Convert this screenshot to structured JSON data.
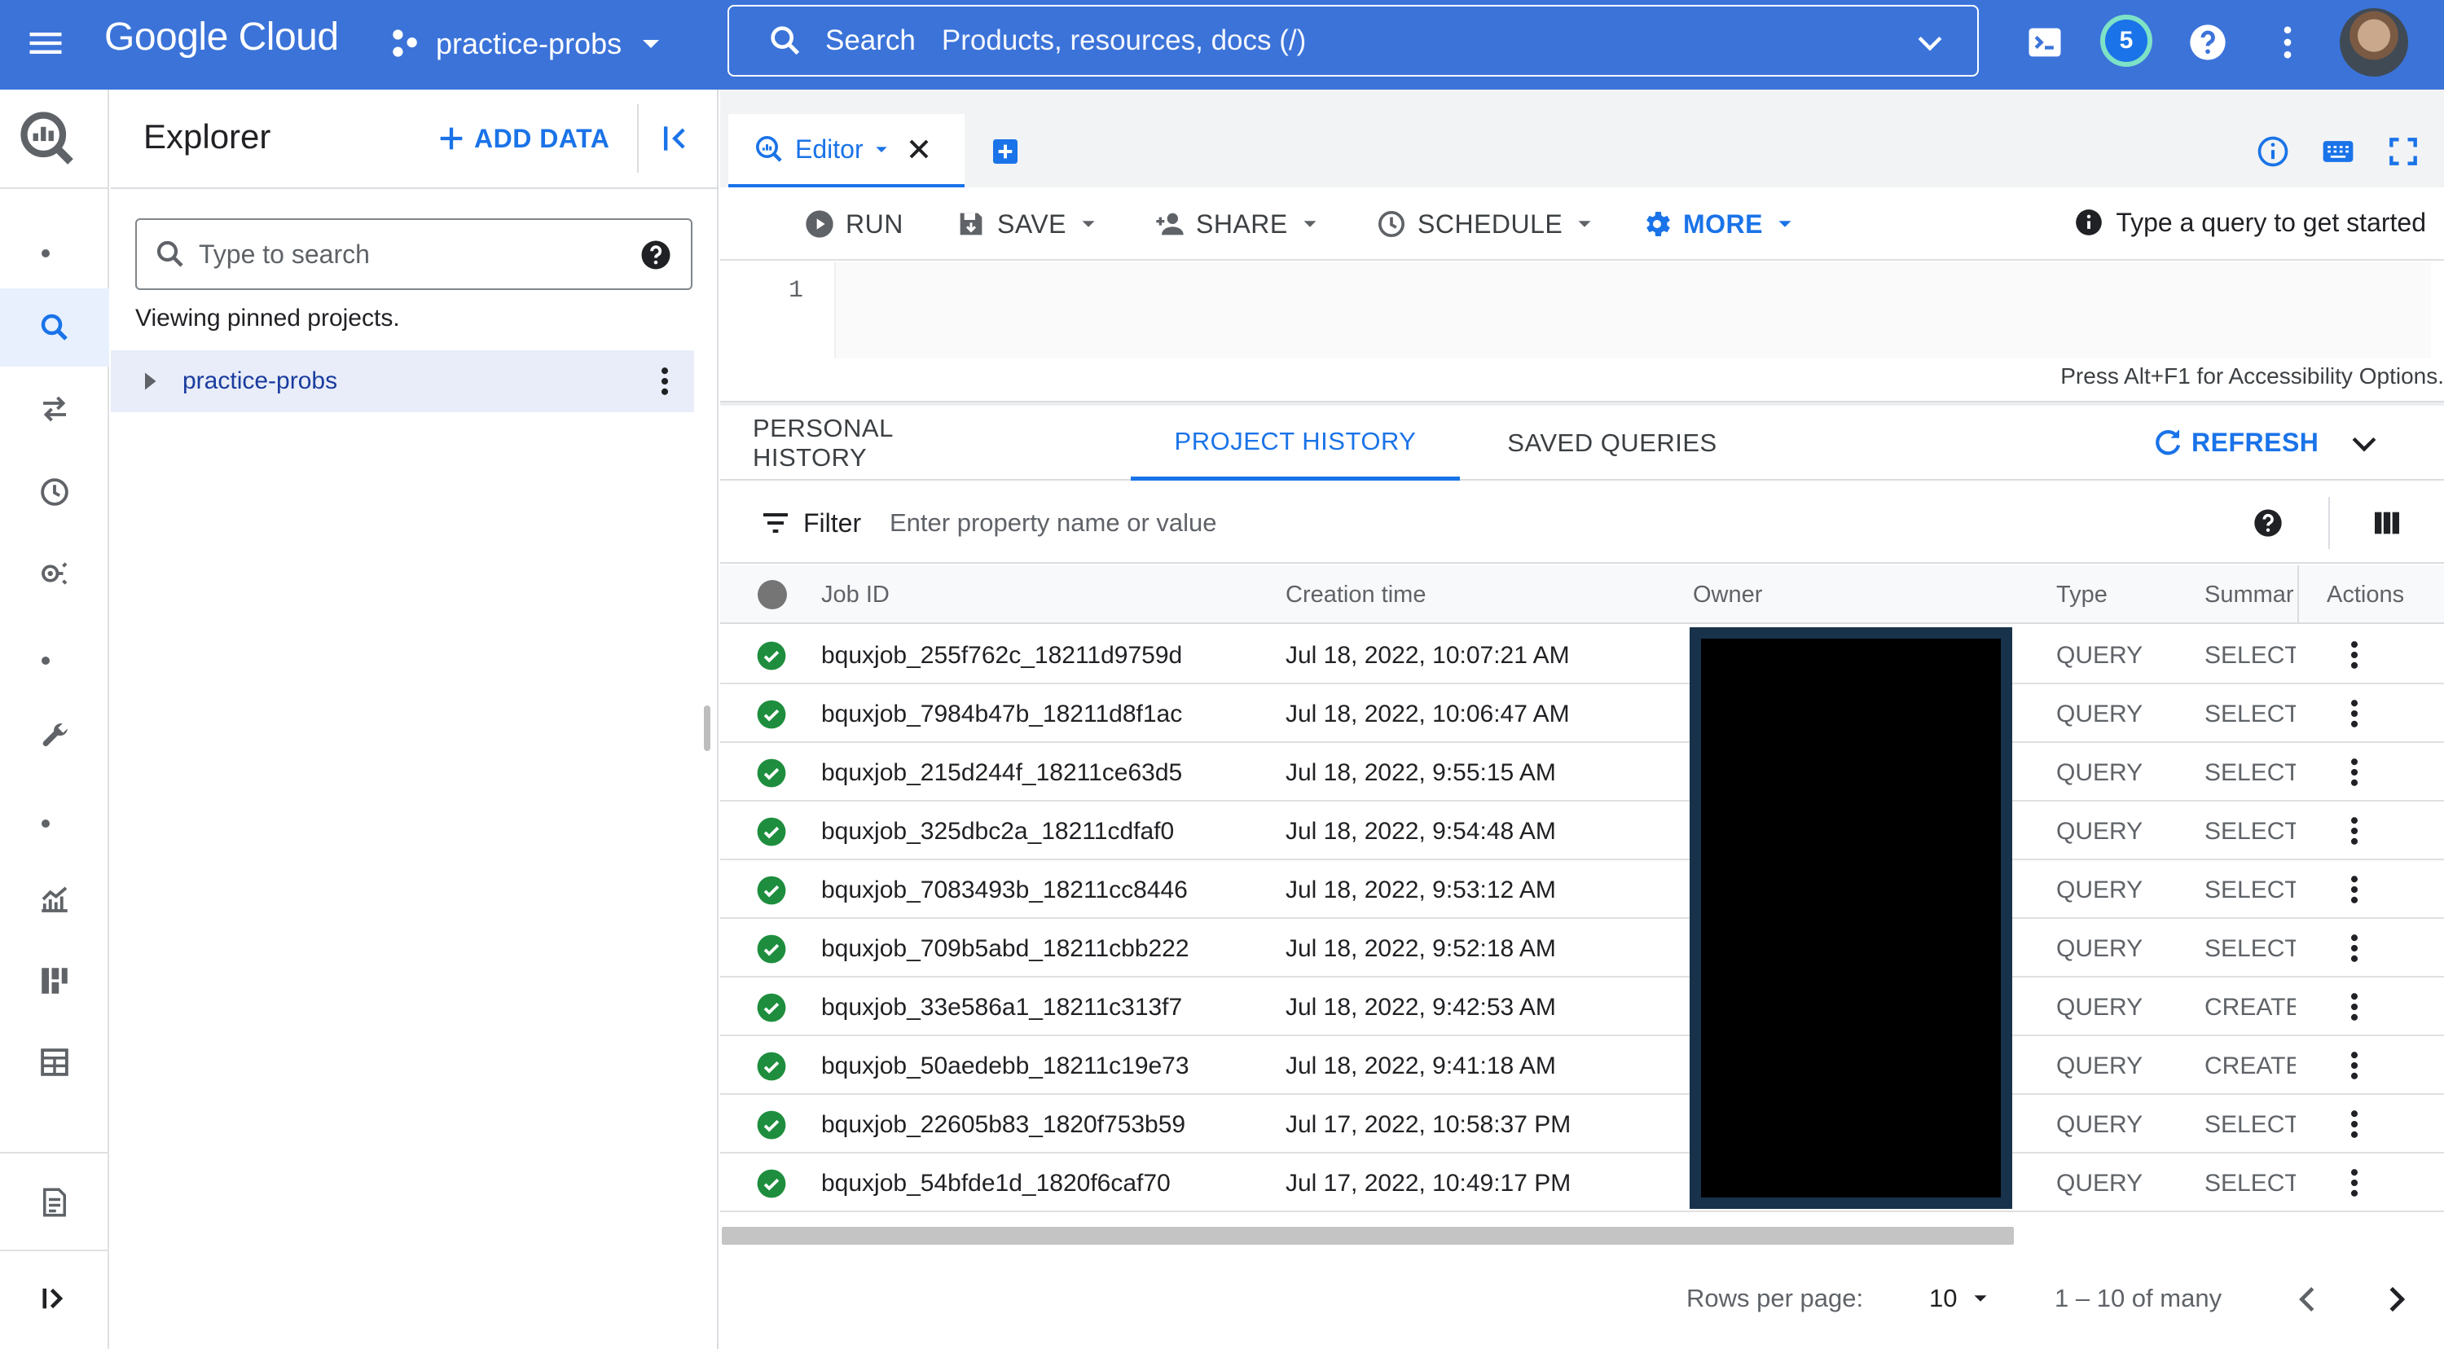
{
  "header": {
    "logo": "Google Cloud",
    "project": "practice-probs",
    "search_label": "Search",
    "search_placeholder": "Products, resources, docs (/)",
    "notifications_count": "5",
    "icons": [
      "menu-icon",
      "cloud-shell-icon",
      "help-icon",
      "more-vert-icon",
      "avatar"
    ]
  },
  "rail": {
    "items": [
      "bigquery-logo",
      "search-icon",
      "transfers-icon",
      "scheduled-queries-icon",
      "analytics-hub-icon",
      "wrench-icon",
      "monitoring-icon",
      "dashboard-icon",
      "table-icon",
      "release-notes-icon",
      "expand-rail-icon"
    ]
  },
  "explorer": {
    "title": "Explorer",
    "add_data": "ADD DATA",
    "search_placeholder": "Type to search",
    "viewing": "Viewing pinned projects.",
    "projects": [
      "practice-probs"
    ]
  },
  "editor": {
    "tab_label": "Editor",
    "toolbar": {
      "run": "RUN",
      "save": "SAVE",
      "share": "SHARE",
      "schedule": "SCHEDULE",
      "more": "MORE"
    },
    "hint": "Type a query to get started",
    "line_number": "1",
    "accessibility": "Press Alt+F1 for Accessibility Options."
  },
  "history": {
    "tabs": [
      "PERSONAL HISTORY",
      "PROJECT HISTORY",
      "SAVED QUERIES"
    ],
    "active_tab": "PROJECT HISTORY",
    "refresh": "REFRESH",
    "filter_label": "Filter",
    "filter_placeholder": "Enter property name or value",
    "columns": [
      "Job ID",
      "Creation time",
      "Owner",
      "Type",
      "Summar",
      "Actions"
    ],
    "rows": [
      {
        "job_id": "bquxjob_255f762c_18211d9759d",
        "created": "Jul 18, 2022, 10:07:21 AM",
        "type": "QUERY",
        "summary": "SELECT"
      },
      {
        "job_id": "bquxjob_7984b47b_18211d8f1ac",
        "created": "Jul 18, 2022, 10:06:47 AM",
        "type": "QUERY",
        "summary": "SELECT"
      },
      {
        "job_id": "bquxjob_215d244f_18211ce63d5",
        "created": "Jul 18, 2022, 9:55:15 AM",
        "type": "QUERY",
        "summary": "SELECT"
      },
      {
        "job_id": "bquxjob_325dbc2a_18211cdfaf0",
        "created": "Jul 18, 2022, 9:54:48 AM",
        "type": "QUERY",
        "summary": "SELECT"
      },
      {
        "job_id": "bquxjob_7083493b_18211cc8446",
        "created": "Jul 18, 2022, 9:53:12 AM",
        "type": "QUERY",
        "summary": "SELECT"
      },
      {
        "job_id": "bquxjob_709b5abd_18211cbb222",
        "created": "Jul 18, 2022, 9:52:18 AM",
        "type": "QUERY",
        "summary": "SELECT"
      },
      {
        "job_id": "bquxjob_33e586a1_18211c313f7",
        "created": "Jul 18, 2022, 9:42:53 AM",
        "type": "QUERY",
        "summary": "CREATE"
      },
      {
        "job_id": "bquxjob_50aedebb_18211c19e73",
        "created": "Jul 18, 2022, 9:41:18 AM",
        "type": "QUERY",
        "summary": "CREATE"
      },
      {
        "job_id": "bquxjob_22605b83_1820f753b59",
        "created": "Jul 17, 2022, 10:58:37 PM",
        "type": "QUERY",
        "summary": "SELECT"
      },
      {
        "job_id": "bquxjob_54bfde1d_1820f6caf70",
        "created": "Jul 17, 2022, 10:49:17 PM",
        "type": "QUERY",
        "summary": "SELECT"
      }
    ],
    "pagination": {
      "rows_per_page_label": "Rows per page:",
      "rows_per_page": "10",
      "range": "1 – 10 of many"
    }
  },
  "colors": {
    "header_bg": "#3b73d9",
    "accent": "#1a73e8",
    "success": "#1e8e3e",
    "selected_bg": "#e8edf9"
  }
}
